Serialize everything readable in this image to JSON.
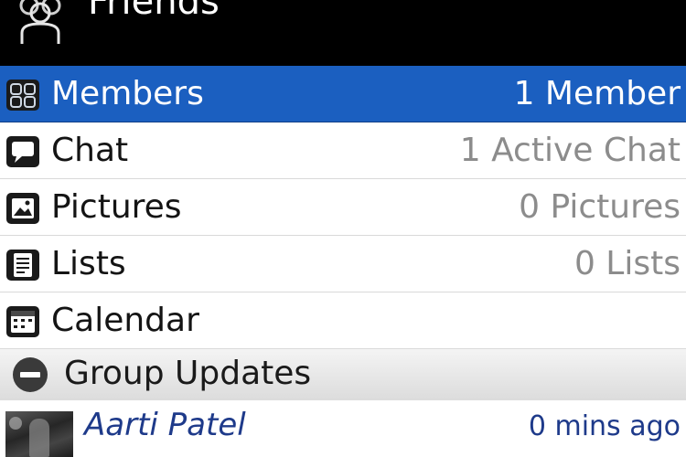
{
  "header": {
    "title": "Friends",
    "icon": "group-icon"
  },
  "menu": {
    "items": [
      {
        "key": "members",
        "label": "Members",
        "value": "1 Member",
        "icon": "members-icon",
        "selected": true
      },
      {
        "key": "chat",
        "label": "Chat",
        "value": "1 Active Chat",
        "icon": "chat-icon",
        "selected": false
      },
      {
        "key": "pictures",
        "label": "Pictures",
        "value": "0 Pictures",
        "icon": "pictures-icon",
        "selected": false
      },
      {
        "key": "lists",
        "label": "Lists",
        "value": "0 Lists",
        "icon": "lists-icon",
        "selected": false
      },
      {
        "key": "calendar",
        "label": "Calendar",
        "value": "",
        "icon": "calendar-icon",
        "selected": false
      }
    ]
  },
  "group_updates": {
    "label": "Group Updates",
    "icon": "collapse-icon",
    "items": [
      {
        "name": "Aarti Patel",
        "time": "0 mins ago",
        "icon": "avatar"
      }
    ]
  },
  "colors": {
    "header_bg": "#000000",
    "selection": "#1b5fc0",
    "value_text": "#8c8c8c",
    "update_text": "#1e3a8a"
  }
}
